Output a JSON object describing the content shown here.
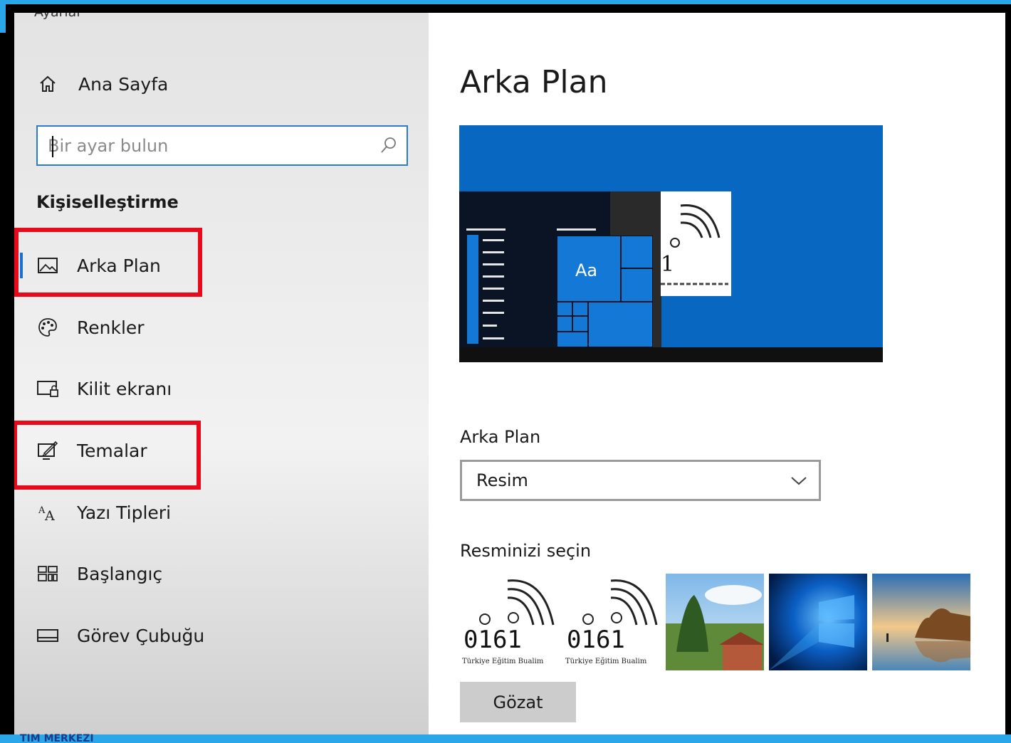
{
  "window": {
    "title": "Ayarlar"
  },
  "sidebar": {
    "home_label": "Ana Sayfa",
    "search_placeholder": "Bir ayar bulun",
    "section_heading": "Kişiselleştirme",
    "items": [
      {
        "label": "Arka Plan",
        "icon": "picture-icon",
        "selected": true
      },
      {
        "label": "Renkler",
        "icon": "palette-icon"
      },
      {
        "label": "Kilit ekranı",
        "icon": "lock-screen-icon"
      },
      {
        "label": "Temalar",
        "icon": "theme-brush-icon"
      },
      {
        "label": "Yazı Tipleri",
        "icon": "font-icon"
      },
      {
        "label": "Başlangıç",
        "icon": "start-grid-icon"
      },
      {
        "label": "Görev Çubuğu",
        "icon": "taskbar-icon"
      }
    ]
  },
  "main": {
    "title": "Arka Plan",
    "preview": {
      "tile_text": "Aa",
      "logo_text": "1"
    },
    "background_label": "Arka Plan",
    "background_select_value": "Resim",
    "choose_picture_label": "Resminizi seçin",
    "thumbnails": [
      {
        "name": "logo-thumb-1",
        "text": "0161",
        "subtext": "Türkiye Eğitim Bualim"
      },
      {
        "name": "logo-thumb-2",
        "text": "0161",
        "subtext": "Türkiye Eğitim Bualim"
      },
      {
        "name": "landscape-thumb"
      },
      {
        "name": "windows-light-thumb"
      },
      {
        "name": "beach-thumb"
      }
    ],
    "browse_label": "Gözat"
  },
  "colors": {
    "accent": "#2b7bd3",
    "highlight": "#e8091a",
    "preview_blue": "#0868c1"
  },
  "footer_text": "TIM MERKEZI"
}
